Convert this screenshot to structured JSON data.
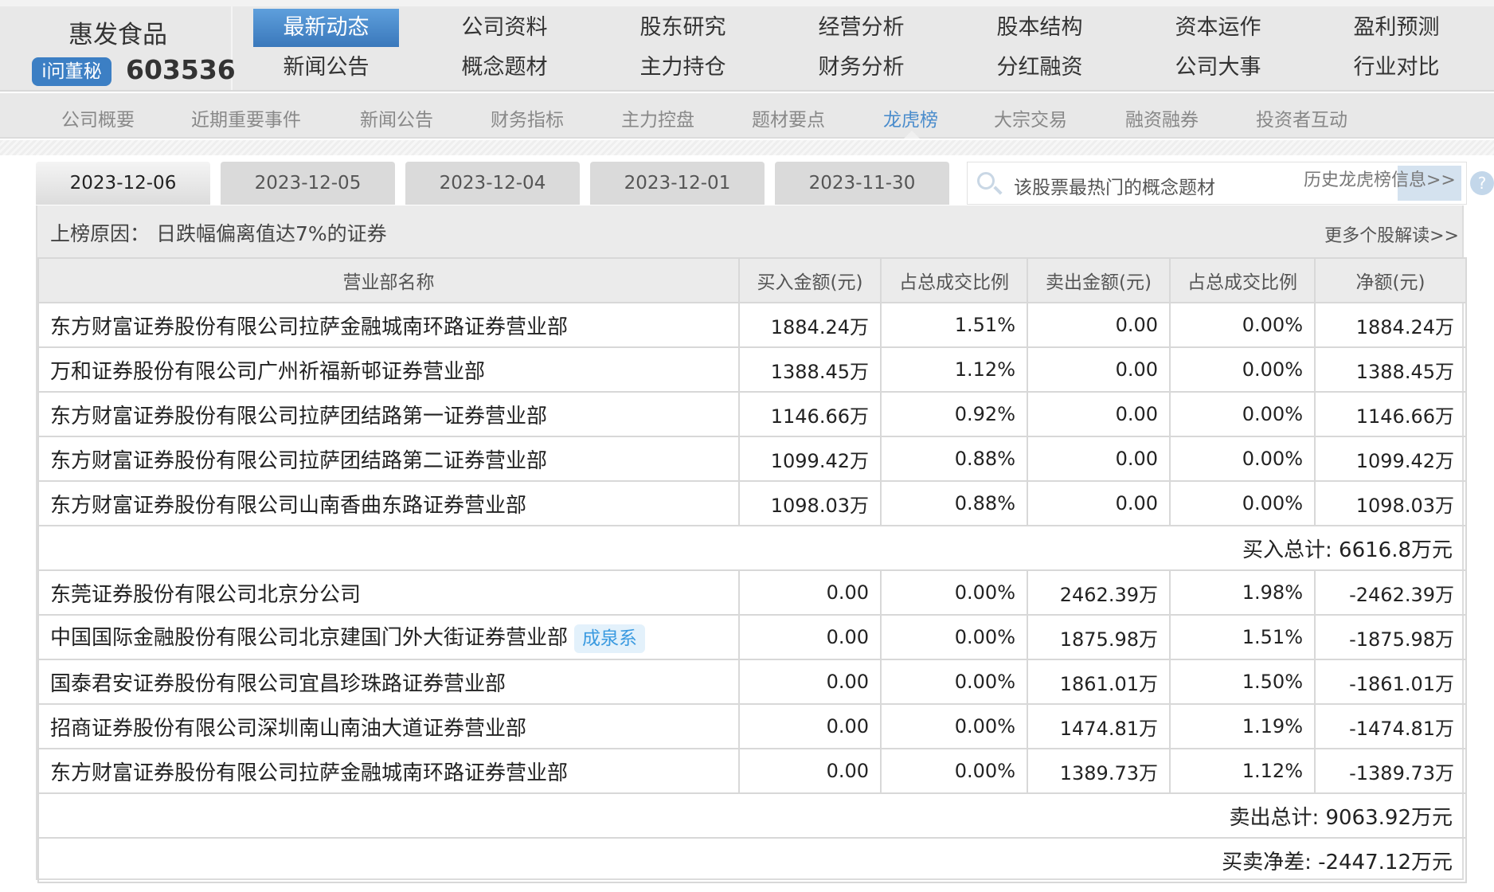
{
  "brand": {
    "name": "惠发食品",
    "badge": "i问董秘",
    "code": "603536"
  },
  "main_nav": [
    [
      "最新动态",
      "新闻公告"
    ],
    [
      "公司资料",
      "概念题材"
    ],
    [
      "股东研究",
      "主力持仓"
    ],
    [
      "经营分析",
      "财务分析"
    ],
    [
      "股本结构",
      "分红融资"
    ],
    [
      "资本运作",
      "公司大事"
    ],
    [
      "盈利预测",
      "行业对比"
    ]
  ],
  "sub_nav": [
    "公司概要",
    "近期重要事件",
    "新闻公告",
    "财务指标",
    "主力控盘",
    "题材要点",
    "龙虎榜",
    "大宗交易",
    "融资融券",
    "投资者互动"
  ],
  "active_sub": "龙虎榜",
  "date_tabs": [
    "2023-12-06",
    "2023-12-05",
    "2023-12-04",
    "2023-12-01",
    "2023-11-30"
  ],
  "search": {
    "placeholder": "该股票最热门的概念题材"
  },
  "history_link": "历史龙虎榜信息>>",
  "help": "?",
  "reason": {
    "text": "上榜原因：  日跌幅偏离值达7%的证券",
    "more": "更多个股解读>>"
  },
  "columns": [
    "营业部名称",
    "买入金额(元)",
    "占总成交比例",
    "卖出金额(元)",
    "占总成交比例",
    "净额(元)"
  ],
  "buy_rows": [
    [
      "东方财富证券股份有限公司拉萨金融城南环路证券营业部",
      "1884.24万",
      "1.51%",
      "0.00",
      "0.00%",
      "1884.24万"
    ],
    [
      "万和证券股份有限公司广州祈福新邨证券营业部",
      "1388.45万",
      "1.12%",
      "0.00",
      "0.00%",
      "1388.45万"
    ],
    [
      "东方财富证券股份有限公司拉萨团结路第一证券营业部",
      "1146.66万",
      "0.92%",
      "0.00",
      "0.00%",
      "1146.66万"
    ],
    [
      "东方财富证券股份有限公司拉萨团结路第二证券营业部",
      "1099.42万",
      "0.88%",
      "0.00",
      "0.00%",
      "1099.42万"
    ],
    [
      "东方财富证券股份有限公司山南香曲东路证券营业部",
      "1098.03万",
      "0.88%",
      "0.00",
      "0.00%",
      "1098.03万"
    ]
  ],
  "buy_total": "买入总计:  6616.8万元",
  "sell_rows": [
    [
      "东莞证券股份有限公司北京分公司",
      "0.00",
      "0.00%",
      "2462.39万",
      "1.98%",
      "-2462.39万"
    ],
    [
      "中国国际金融股份有限公司北京建国门外大街证券营业部",
      "0.00",
      "0.00%",
      "1875.98万",
      "1.51%",
      "-1875.98万"
    ],
    [
      "国泰君安证券股份有限公司宜昌珍珠路证券营业部",
      "0.00",
      "0.00%",
      "1861.01万",
      "1.50%",
      "-1861.01万"
    ],
    [
      "招商证券股份有限公司深圳南山南油大道证券营业部",
      "0.00",
      "0.00%",
      "1474.81万",
      "1.19%",
      "-1474.81万"
    ],
    [
      "东方财富证券股份有限公司拉萨金融城南环路证券营业部",
      "0.00",
      "0.00%",
      "1389.73万",
      "1.12%",
      "-1389.73万"
    ]
  ],
  "sell_tag": "成泉系",
  "sell_total": "卖出总计:  9063.92万元",
  "net": "买卖净差:  -2447.12万元"
}
